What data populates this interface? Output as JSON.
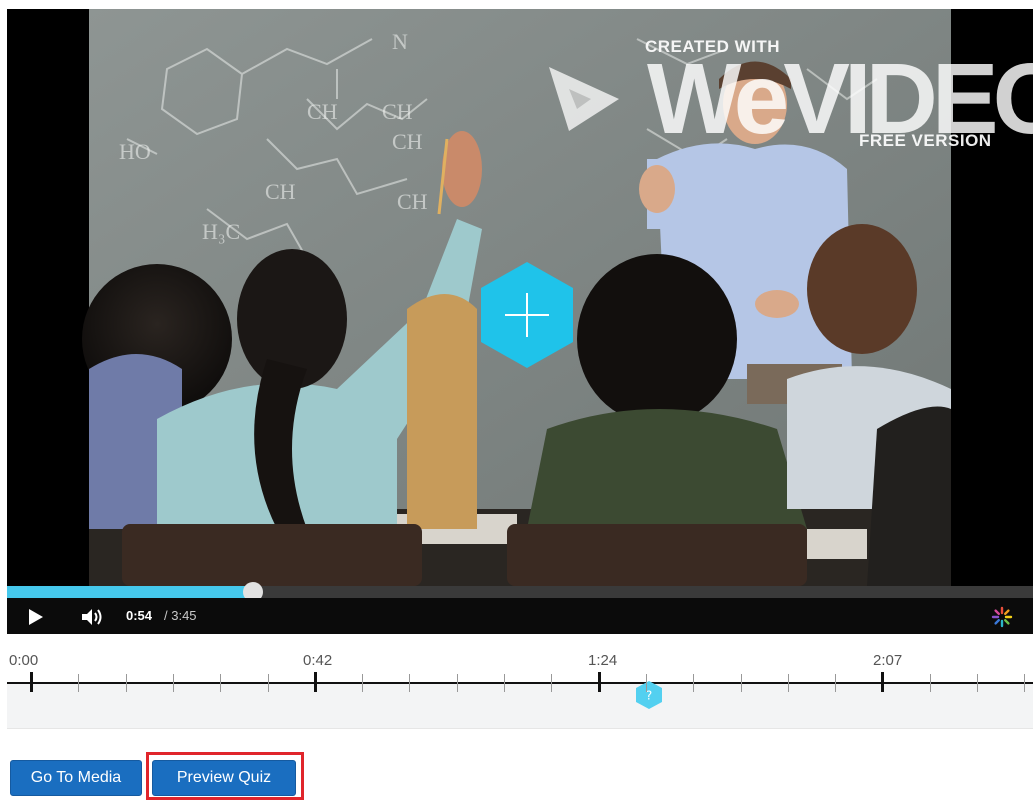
{
  "video": {
    "watermark_top": "CREATED WITH",
    "watermark_logo": "WeVIDEO",
    "watermark_bottom": "FREE VERSION",
    "progress_fraction": 0.24,
    "current_time": "0:54",
    "total_time": "/ 3:45",
    "accent_color": "#45c8ec"
  },
  "timeline": {
    "labels": [
      "0:00",
      "0:42",
      "1:24",
      "2:07"
    ],
    "marker_icon": "quiz-marker-icon"
  },
  "actions": {
    "go_to_media": "Go To Media",
    "preview_quiz": "Preview Quiz"
  }
}
